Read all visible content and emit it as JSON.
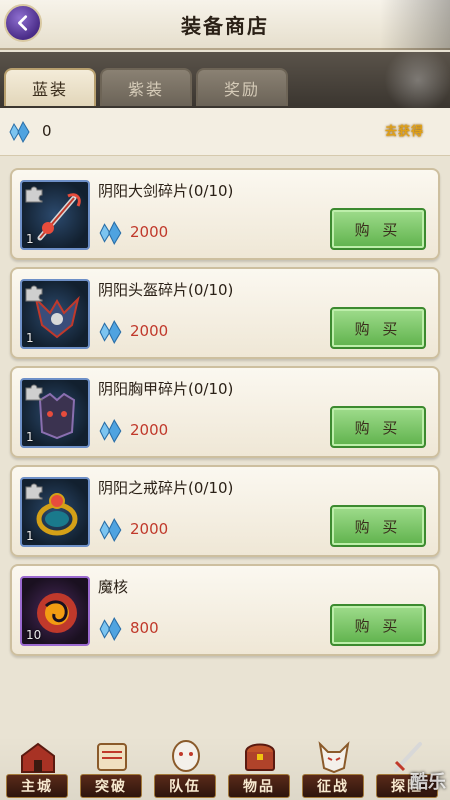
{
  "header": {
    "title": "装备商店",
    "back_icon": "chevron-left-icon"
  },
  "tabs": [
    {
      "label": "蓝装",
      "active": true
    },
    {
      "label": "紫装",
      "active": false
    },
    {
      "label": "奖励",
      "active": false
    }
  ],
  "currency": {
    "icon": "crystal-icon",
    "amount": "0",
    "get_more": "去获得"
  },
  "items": [
    {
      "name": "阴阳大剑碎片(0/10)",
      "price": "2000",
      "qty": "1",
      "buy_label": "购 买",
      "icon": "sword-icon",
      "rarity": "blue"
    },
    {
      "name": "阴阳头盔碎片(0/10)",
      "price": "2000",
      "qty": "1",
      "buy_label": "购 买",
      "icon": "helmet-icon",
      "rarity": "blue"
    },
    {
      "name": "阴阳胸甲碎片(0/10)",
      "price": "2000",
      "qty": "1",
      "buy_label": "购 买",
      "icon": "armor-icon",
      "rarity": "blue"
    },
    {
      "name": "阴阳之戒碎片(0/10)",
      "price": "2000",
      "qty": "1",
      "buy_label": "购 买",
      "icon": "ring-icon",
      "rarity": "blue"
    },
    {
      "name": "魔核",
      "price": "800",
      "qty": "10",
      "buy_label": "购 买",
      "icon": "magic-core-icon",
      "rarity": "purple"
    }
  ],
  "bottom_nav": [
    {
      "label": "主城",
      "icon": "castle-icon"
    },
    {
      "label": "突破",
      "icon": "scroll-icon"
    },
    {
      "label": "队伍",
      "icon": "mask-icon"
    },
    {
      "label": "物品",
      "icon": "chest-icon"
    },
    {
      "label": "征战",
      "icon": "fox-mask-icon"
    },
    {
      "label": "探险",
      "icon": "sword-icon"
    }
  ],
  "watermark": "酷乐",
  "colors": {
    "buy_button": "#5fb24c",
    "price_text": "#c0392b",
    "crystal": "#4fa3e0",
    "accent_purple": "#4a2c88"
  }
}
